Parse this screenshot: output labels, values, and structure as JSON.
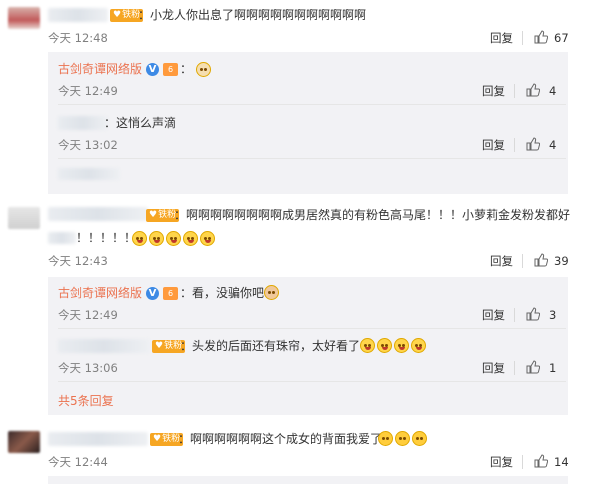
{
  "comments": [
    {
      "text": "：小龙人你出息了啊啊啊啊啊啊啊啊啊啊啊",
      "badge": "铁粉",
      "time": "今天 12:48",
      "reply": "回复",
      "likes": "67",
      "replies": [
        {
          "name": "古剑奇谭网络版",
          "text": "：",
          "time": "今天 12:49",
          "reply": "回复",
          "likes": "4"
        },
        {
          "text": "：这悄么声滴",
          "time": "今天 13:02",
          "reply": "回复",
          "likes": "4"
        }
      ]
    },
    {
      "text": "：啊啊啊啊啊啊啊啊成男居然真的有粉色高马尾！！！小萝莉金发粉发都好",
      "text2": "！！！！！",
      "badge": "铁粉",
      "time": "今天 12:43",
      "reply": "回复",
      "likes": "39",
      "replies": [
        {
          "name": "古剑奇谭网络版",
          "text": "：看，没骗你吧",
          "time": "今天 12:49",
          "reply": "回复",
          "likes": "3"
        },
        {
          "badge": "铁粉",
          "text": "：头发的后面还有珠帘，太好看了",
          "time": "今天 13:06",
          "reply": "回复",
          "likes": "1"
        }
      ],
      "more": "共5条回复"
    },
    {
      "text": "：啊啊啊啊啊啊这个成女的背面我爱了",
      "badge": "铁粉",
      "time": "今天 12:44",
      "reply": "回复",
      "likes": "14"
    }
  ]
}
